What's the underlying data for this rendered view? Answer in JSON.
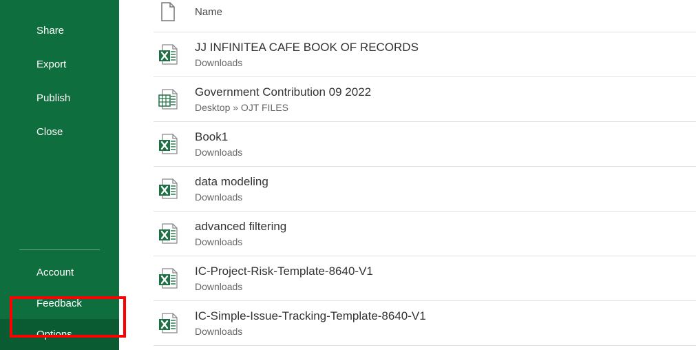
{
  "sidebar": {
    "items": [
      {
        "label": "Share"
      },
      {
        "label": "Export"
      },
      {
        "label": "Publish"
      },
      {
        "label": "Close"
      }
    ],
    "bottom": [
      {
        "label": "Account"
      },
      {
        "label": "Feedback"
      },
      {
        "label": "Options"
      }
    ]
  },
  "list": {
    "header": {
      "label": "Name"
    },
    "files": [
      {
        "name": "JJ INFINITEA CAFE BOOK OF RECORDS",
        "path": "Downloads",
        "icon": "xlsx"
      },
      {
        "name": "Government Contribution 09 2022",
        "path": "Desktop » OJT FILES",
        "icon": "xls"
      },
      {
        "name": "Book1",
        "path": "Downloads",
        "icon": "xlsx"
      },
      {
        "name": "data modeling",
        "path": "Downloads",
        "icon": "xlsx"
      },
      {
        "name": "advanced filtering",
        "path": "Downloads",
        "icon": "xlsx"
      },
      {
        "name": "IC-Project-Risk-Template-8640-V1",
        "path": "Downloads",
        "icon": "xlsx"
      },
      {
        "name": "IC-Simple-Issue-Tracking-Template-8640-V1",
        "path": "Downloads",
        "icon": "xlsx"
      }
    ]
  }
}
